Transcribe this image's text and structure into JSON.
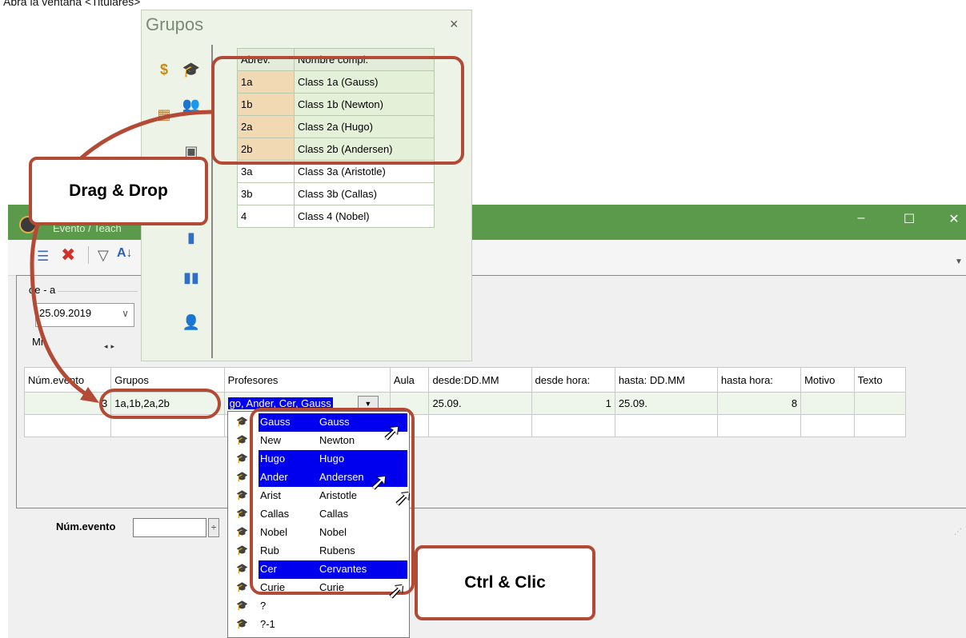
{
  "caption": "Abra la ventana <Titulares>",
  "main_window": {
    "title": "Evento / Teach",
    "minimize": "–",
    "maximize": "☐",
    "close": "✕",
    "date_group_label": "de - a",
    "date_value": "25.09.2019",
    "day_label": "Mi",
    "event_num_label": "Núm.evento",
    "grid": {
      "headers": [
        "Núm.evento",
        "Grupos",
        "Profesores",
        "Aula",
        "desde:DD.MM",
        "desde hora:",
        "hasta: DD.MM",
        "hasta hora:",
        "Motivo",
        "Texto"
      ],
      "row": {
        "num": "3",
        "grupos": "1a,1b,2a,2b",
        "profesores": "go, Ander, Cer, Gauss",
        "aula": "",
        "desde_dd": "25.09.",
        "desde_hora": "1",
        "hasta_dd": "25.09.",
        "hasta_hora": "8",
        "motivo": "",
        "texto": ""
      }
    }
  },
  "grupos_panel": {
    "title": "Grupos",
    "close": "×",
    "col_abrev": "Abrev.",
    "col_nombre": "Nombre compl.",
    "rows": [
      {
        "abrev": "1a",
        "nombre": "Class 1a (Gauss)"
      },
      {
        "abrev": "1b",
        "nombre": "Class 1b (Newton)"
      },
      {
        "abrev": "2a",
        "nombre": "Class 2a (Hugo)"
      },
      {
        "abrev": "2b",
        "nombre": "Class 2b (Andersen)"
      },
      {
        "abrev": "3a",
        "nombre": "Class 3a (Aristotle)"
      },
      {
        "abrev": "3b",
        "nombre": "Class 3b (Callas)"
      },
      {
        "abrev": "4",
        "nombre": "Class 4 (Nobel)"
      }
    ]
  },
  "teacher_dropdown": [
    {
      "abrev": "Gauss",
      "nombre": "Gauss",
      "selected": true
    },
    {
      "abrev": "New",
      "nombre": "Newton",
      "selected": false
    },
    {
      "abrev": "Hugo",
      "nombre": "Hugo",
      "selected": true
    },
    {
      "abrev": "Ander",
      "nombre": "Andersen",
      "selected": true
    },
    {
      "abrev": "Arist",
      "nombre": "Aristotle",
      "selected": false
    },
    {
      "abrev": "Callas",
      "nombre": "Callas",
      "selected": false
    },
    {
      "abrev": "Nobel",
      "nombre": "Nobel",
      "selected": false
    },
    {
      "abrev": "Rub",
      "nombre": "Rubens",
      "selected": false
    },
    {
      "abrev": "Cer",
      "nombre": "Cervantes",
      "selected": true
    },
    {
      "abrev": "Curie",
      "nombre": "Curie",
      "selected": false
    },
    {
      "abrev": "?",
      "nombre": "",
      "selected": false
    },
    {
      "abrev": "?-1",
      "nombre": "",
      "selected": false
    }
  ],
  "callouts": {
    "drag_drop": "Drag & Drop",
    "ctrl_click": "Ctrl & Clic"
  },
  "colors": {
    "titlebar": "#5b9a4a",
    "callout_border": "#b24a35",
    "selection": "#0000ee"
  }
}
